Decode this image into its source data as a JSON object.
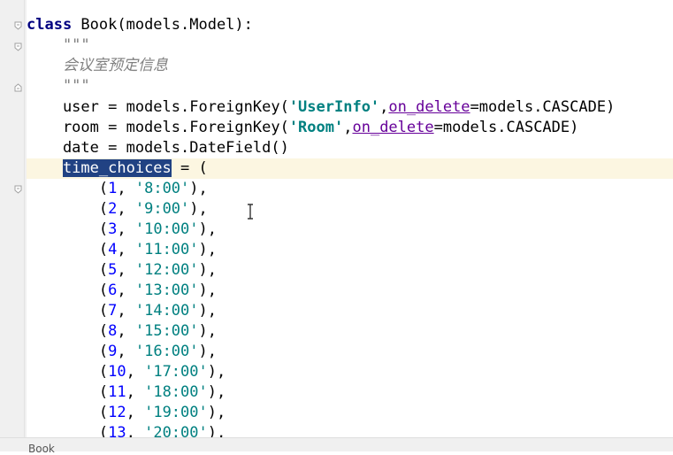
{
  "editor": {
    "lines": [
      {
        "kind": "class_def",
        "keyword": "class",
        "text": " Book(models.Model):"
      },
      {
        "kind": "doc",
        "text": "    \"\"\""
      },
      {
        "kind": "doc",
        "text": "    会议室预定信息"
      },
      {
        "kind": "doc",
        "text": "    \"\"\""
      },
      {
        "kind": "fk",
        "prefix": "    user = models.ForeignKey(",
        "model": "'UserInfo'",
        "comma": ",",
        "param": "on_delete",
        "suffix": "=models.CASCADE)"
      },
      {
        "kind": "fk",
        "prefix": "    room = models.ForeignKey(",
        "model": "'Room'",
        "comma": ",",
        "param": "on_delete",
        "suffix": "=models.CASCADE)"
      },
      {
        "kind": "plain",
        "text": "    date = models.DateField()"
      },
      {
        "kind": "selected",
        "indent": "    ",
        "selected": "time_choices",
        "rest": " = ("
      },
      {
        "kind": "tuple",
        "num": "1",
        "val": "'8:00'"
      },
      {
        "kind": "tuple",
        "num": "2",
        "val": "'9:00'"
      },
      {
        "kind": "tuple",
        "num": "3",
        "val": "'10:00'"
      },
      {
        "kind": "tuple",
        "num": "4",
        "val": "'11:00'"
      },
      {
        "kind": "tuple",
        "num": "5",
        "val": "'12:00'"
      },
      {
        "kind": "tuple",
        "num": "6",
        "val": "'13:00'"
      },
      {
        "kind": "tuple",
        "num": "7",
        "val": "'14:00'"
      },
      {
        "kind": "tuple",
        "num": "8",
        "val": "'15:00'"
      },
      {
        "kind": "tuple",
        "num": "9",
        "val": "'16:00'"
      },
      {
        "kind": "tuple",
        "num": "10",
        "val": "'17:00'"
      },
      {
        "kind": "tuple",
        "num": "11",
        "val": "'18:00'"
      },
      {
        "kind": "tuple",
        "num": "12",
        "val": "'19:00'"
      },
      {
        "kind": "tuple",
        "num": "13",
        "val": "'20:00'"
      }
    ]
  },
  "status_bar": {
    "breadcrumb": "Book"
  },
  "colors": {
    "selection": "#214283",
    "current_line": "#fcf6e1",
    "string": "#008080",
    "number": "#0000ff",
    "keyword": "#000080"
  }
}
